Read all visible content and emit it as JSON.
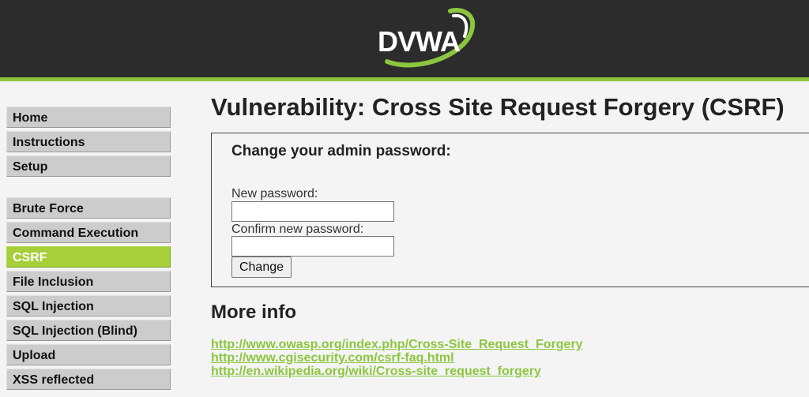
{
  "header": {
    "logo_text": "DVWA",
    "colors": {
      "header_bg": "#2c2c2c",
      "accent": "#8cc63f"
    }
  },
  "sidebar": {
    "groups": [
      [
        {
          "label": "Home"
        },
        {
          "label": "Instructions"
        },
        {
          "label": "Setup"
        }
      ],
      [
        {
          "label": "Brute Force"
        },
        {
          "label": "Command Execution"
        },
        {
          "label": "CSRF",
          "active": true
        },
        {
          "label": "File Inclusion"
        },
        {
          "label": "SQL Injection"
        },
        {
          "label": "SQL Injection (Blind)"
        },
        {
          "label": "Upload"
        },
        {
          "label": "XSS reflected"
        }
      ]
    ]
  },
  "main": {
    "title": "Vulnerability: Cross Site Request Forgery (CSRF)",
    "form": {
      "heading": "Change your admin password:",
      "new_password_label": "New password:",
      "new_password_value": "",
      "confirm_password_label": "Confirm new password:",
      "confirm_password_value": "",
      "submit_label": "Change"
    },
    "more_info": {
      "title": "More info",
      "links": [
        "http://www.owasp.org/index.php/Cross-Site_Request_Forgery",
        "http://www.cgisecurity.com/csrf-faq.html",
        "http://en.wikipedia.org/wiki/Cross-site_request_forgery"
      ]
    }
  }
}
